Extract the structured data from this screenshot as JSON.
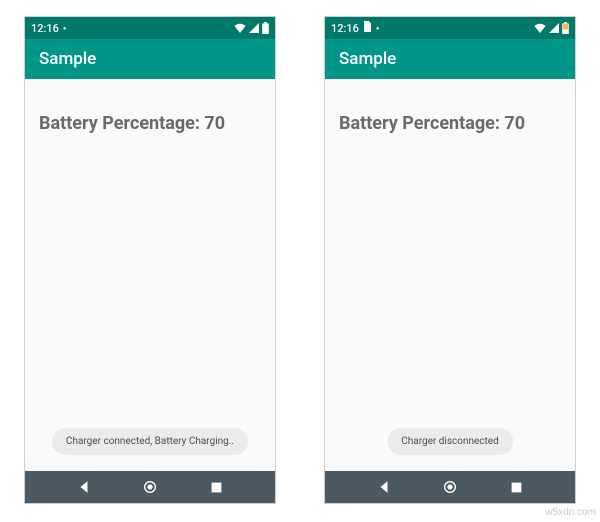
{
  "devices": [
    {
      "status": {
        "time": "12:16",
        "has_doc_icon": false
      },
      "app_title": "Sample",
      "battery_label": "Battery Percentage: 70",
      "toast": "Charger connected, Battery Charging.."
    },
    {
      "status": {
        "time": "12:16",
        "has_doc_icon": true
      },
      "app_title": "Sample",
      "battery_label": "Battery Percentage: 70",
      "toast": "Charger disconnected"
    }
  ],
  "watermark": "w5xdn.com"
}
